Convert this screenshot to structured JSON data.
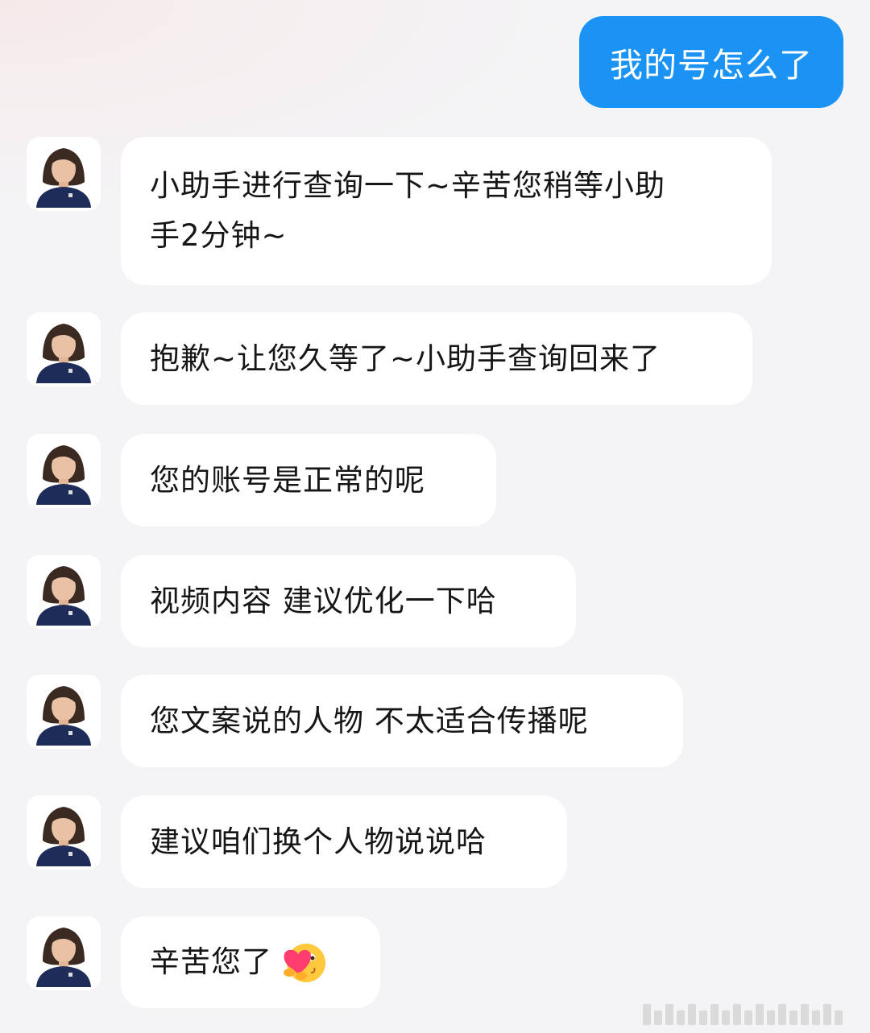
{
  "user_message": "我的号怎么了",
  "assistant_messages": [
    {
      "line1": "小助手进行查询一下~辛苦您稍等小助",
      "line2": "手2分钟~"
    },
    {
      "line1": "抱歉~让您久等了~小助手查询回来了"
    },
    {
      "line1": "您的账号是正常的呢"
    },
    {
      "line1": "视频内容 建议优化一下哈"
    },
    {
      "line1": "您文案说的人物 不太适合传播呢"
    },
    {
      "line1": "建议咱们换个人物说说哈"
    },
    {
      "line1": "辛苦您了",
      "emoji": "hug-heart-emoji"
    }
  ],
  "icons": {
    "avatar": "assistant-avatar-icon",
    "emoji": "hug-heart-emoji-icon"
  },
  "colors": {
    "user_bubble": "#1b93f5",
    "assistant_bubble": "#ffffff",
    "background": "#f4f4f6"
  }
}
